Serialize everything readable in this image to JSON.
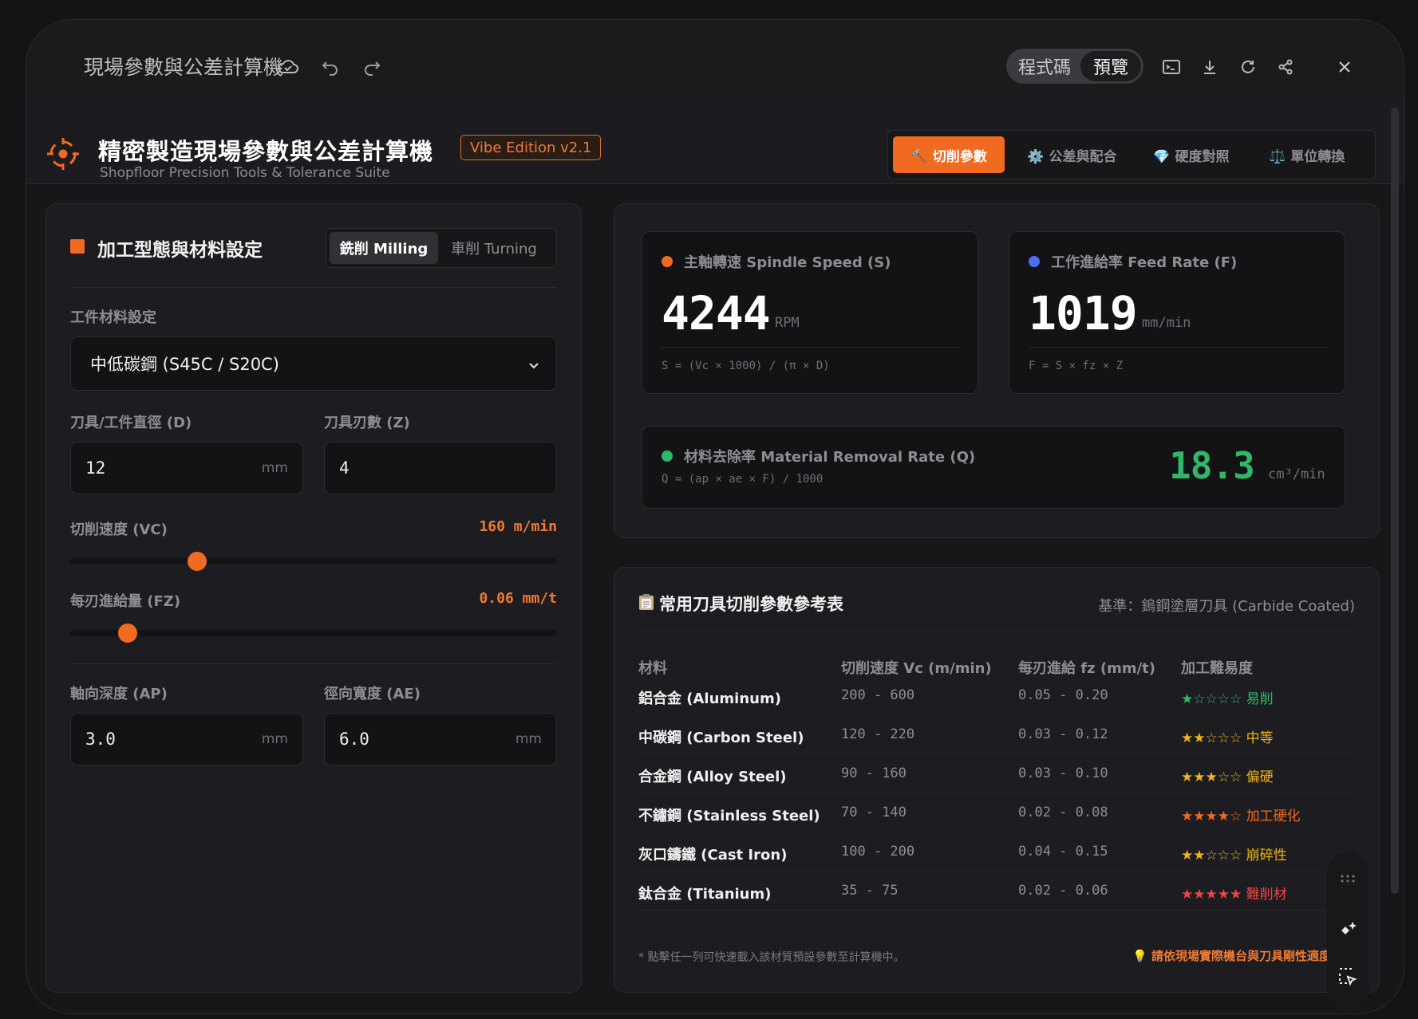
{
  "window": {
    "title": "現場參數與公差計算機",
    "code_label": "程式碼",
    "preview_label": "預覽"
  },
  "app": {
    "title": "精密製造現場參數與公差計算機",
    "badge": "Vibe Edition v2.1",
    "subtitle": "Shopfloor Precision Tools & Tolerance Suite",
    "accent_color": "#f06a22"
  },
  "nav": {
    "cutting": "🔨 切削參數",
    "tolerance": "⚙️ 公差與配合",
    "hardness": "💎 硬度對照",
    "units": "⚖️ 單位轉換"
  },
  "settings": {
    "title": "加工型態與材料設定",
    "mode_milling": "銑削 Milling",
    "mode_turning": "車削 Turning",
    "material_label": "工件材料設定",
    "material_value": "中低碳鋼 (S45C / S20C)",
    "diameter_label": "刀具/工件直徑 (D)",
    "diameter_value": "12",
    "diameter_unit": "mm",
    "teeth_label": "刀具刃數 (Z)",
    "teeth_value": "4",
    "vc_label": "切削速度 (VC)",
    "vc_display": "160 m/min",
    "vc_fraction": 0.26,
    "fz_label": "每刃進給量 (FZ)",
    "fz_display": "0.06 mm/t",
    "fz_fraction": 0.118,
    "ap_label": "軸向深度 (AP)",
    "ap_value": "3.0",
    "ap_unit": "mm",
    "ae_label": "徑向寬度 (AE)",
    "ae_value": "6.0",
    "ae_unit": "mm"
  },
  "results": {
    "spindle": {
      "label": "主軸轉速 Spindle Speed (S)",
      "value": "4244",
      "unit": "RPM",
      "formula": "S = (Vc × 1000) / (π × D)",
      "color": "#f06a22"
    },
    "feed": {
      "label": "工作進給率 Feed Rate (F)",
      "value": "1019",
      "unit": "mm/min",
      "formula": "F = S × fz × Z",
      "color": "#4f6df5"
    },
    "mrr": {
      "label": "材料去除率 Material Removal Rate (Q)",
      "formula": "Q = (ap × ae × F) / 1000",
      "value": "18.3",
      "unit": "cm³/min",
      "color": "#2fb86a"
    }
  },
  "reference": {
    "title": "常用刀具切削參數參考表",
    "note": "基準：鎢鋼塗層刀具 (Carbide Coated)",
    "headers": [
      "材料",
      "切削速度 Vc (m/min)",
      "每刃進給 fz (mm/t)",
      "加工難易度"
    ],
    "rows": [
      {
        "material": "鋁合金 (Aluminum)",
        "vc": "200 - 600",
        "fz": "0.05 - 0.20",
        "difficulty": "★☆☆☆☆ 易削",
        "color": "#2fb86a"
      },
      {
        "material": "中碳鋼 (Carbon Steel)",
        "vc": "120 - 220",
        "fz": "0.03 - 0.12",
        "difficulty": "★★☆☆☆ 中等",
        "color": "#f0b31a"
      },
      {
        "material": "合金鋼 (Alloy Steel)",
        "vc": "90 - 160",
        "fz": "0.03 - 0.10",
        "difficulty": "★★★☆☆ 偏硬",
        "color": "#f0b31a"
      },
      {
        "material": "不鏽鋼 (Stainless Steel)",
        "vc": "70 - 140",
        "fz": "0.02 - 0.08",
        "difficulty": "★★★★☆ 加工硬化",
        "color": "#f06a22"
      },
      {
        "material": "灰口鑄鐵 (Cast Iron)",
        "vc": "100 - 200",
        "fz": "0.04 - 0.15",
        "difficulty": "★★☆☆☆ 崩碎性",
        "color": "#f0b31a"
      },
      {
        "material": "鈦合金 (Titanium)",
        "vc": "35 - 75",
        "fz": "0.02 - 0.06",
        "difficulty": "★★★★★ 難削材",
        "color": "#ef4444"
      }
    ],
    "footnote": "* 點擊任一列可快速載入該材質預設參數至計算機中。",
    "tip": "💡 請依現場實際機台與刀具剛性適度"
  }
}
